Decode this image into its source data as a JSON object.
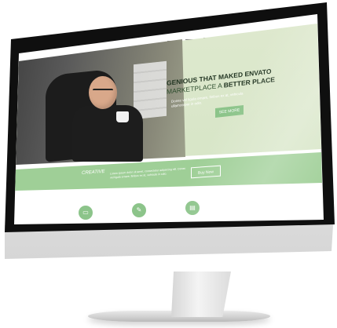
{
  "site": {
    "logo": "ENVATO",
    "hero": {
      "heading_line1": "GENIOUS THAT MAKED ENVATO",
      "heading_line2_prefix": "MARKETPLACE A ",
      "heading_line2_bold": "BETTER PLACE",
      "body_line1": "Donec vel ligula ornare, finibus ex at, vehicula",
      "body_line2": "ullamcorper in odio.",
      "cta_label": "SEE MORE"
    },
    "band": {
      "logo_text": "CREATIVE",
      "text": "Lorem ipsum dolor sit amet, consectetur adipiscing elit. Donec vel ligula ornare, finibus ex at, vehicula in odio.",
      "button_label": "Buy Now"
    },
    "features": [
      {
        "icon": "device-icon"
      },
      {
        "icon": "brush-icon"
      },
      {
        "icon": "document-icon"
      }
    ]
  }
}
